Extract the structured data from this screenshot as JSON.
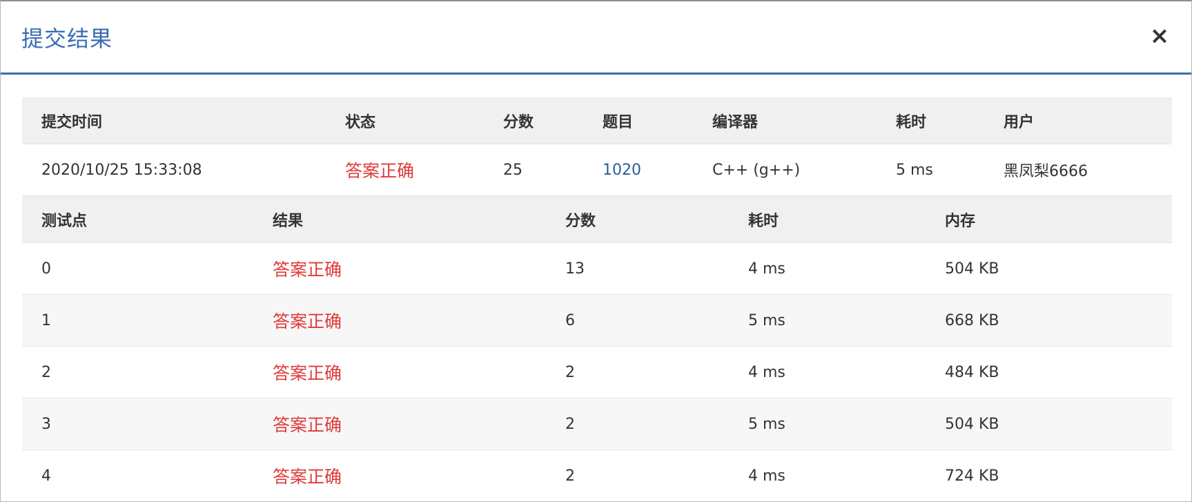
{
  "modal": {
    "title": "提交结果",
    "close_label": "×"
  },
  "submission": {
    "headers": {
      "time": "提交时间",
      "status": "状态",
      "score": "分数",
      "problem": "题目",
      "compiler": "编译器",
      "elapsed": "耗时",
      "user": "用户"
    },
    "row": {
      "time": "2020/10/25 15:33:08",
      "status": "答案正确",
      "score": "25",
      "problem": "1020",
      "compiler": "C++ (g++)",
      "elapsed": "5 ms",
      "user": "黑凤梨6666"
    }
  },
  "testcases": {
    "headers": {
      "case": "测试点",
      "result": "结果",
      "score": "分数",
      "elapsed": "耗时",
      "memory": "内存"
    },
    "rows": [
      {
        "case": "0",
        "result": "答案正确",
        "score": "13",
        "elapsed": "4 ms",
        "memory": "504 KB"
      },
      {
        "case": "1",
        "result": "答案正确",
        "score": "6",
        "elapsed": "5 ms",
        "memory": "668 KB"
      },
      {
        "case": "2",
        "result": "答案正确",
        "score": "2",
        "elapsed": "4 ms",
        "memory": "484 KB"
      },
      {
        "case": "3",
        "result": "答案正确",
        "score": "2",
        "elapsed": "5 ms",
        "memory": "504 KB"
      },
      {
        "case": "4",
        "result": "答案正确",
        "score": "2",
        "elapsed": "4 ms",
        "memory": "724 KB"
      }
    ]
  },
  "colors": {
    "accent": "#3b6cb4",
    "status_ok": "#e03a3a",
    "link": "#2a5d9a"
  }
}
